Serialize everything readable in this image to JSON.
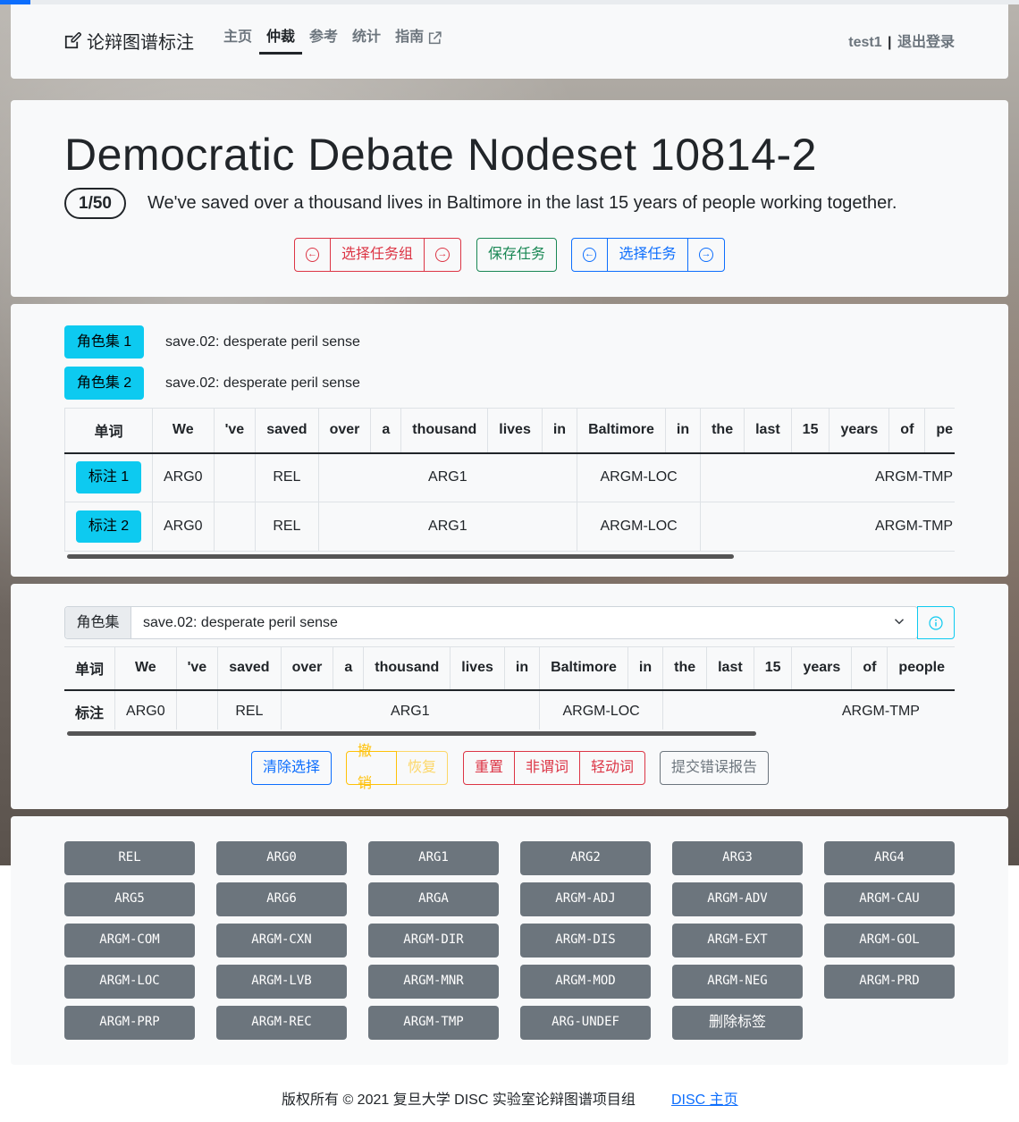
{
  "progress": 0.03,
  "colors": {
    "accent": "#0d6efd",
    "info": "#0dcaf0",
    "danger": "#dc3545",
    "success": "#198754",
    "warning": "#ffc107",
    "secondary": "#6c757d"
  },
  "nav": {
    "brand": "论辩图谱标注",
    "links": [
      "主页",
      "仲裁",
      "参考",
      "统计",
      "指南"
    ],
    "active": "仲裁",
    "user": "test1",
    "sep": "|",
    "logout": "退出登录"
  },
  "header": {
    "title": "Democratic Debate Nodeset 10814-2",
    "counter": "1/50",
    "sentence": "We've saved over a thousand lives in Baltimore in the last 15 years of people working together.",
    "select_group": "选择任务组",
    "save_task": "保存任务",
    "select_task": "选择任务"
  },
  "rolesets": [
    {
      "button": "角色集 1",
      "text": "save.02: desperate peril sense"
    },
    {
      "button": "角色集 2",
      "text": "save.02: desperate peril sense"
    }
  ],
  "table1": {
    "head": "单词",
    "words": [
      "We",
      "'ve",
      "saved",
      "over",
      "a",
      "thousand",
      "lives",
      "in",
      "Baltimore",
      "in",
      "the",
      "last",
      "15",
      "years",
      "of",
      "pe"
    ],
    "rows": [
      {
        "tag": "标注 1",
        "cells": [
          "ARG0",
          "",
          "REL",
          "ARG1",
          "ARGM-LOC",
          "ARGM-TMP"
        ]
      },
      {
        "tag": "标注 2",
        "cells": [
          "ARG0",
          "",
          "REL",
          "ARG1",
          "ARGM-LOC",
          "ARGM-TMP"
        ]
      }
    ]
  },
  "editor": {
    "roleset_label": "角色集",
    "roleset_value": "save.02: desperate peril sense",
    "head": "单词",
    "row_label": "标注",
    "words": [
      "We",
      "'ve",
      "saved",
      "over",
      "a",
      "thousand",
      "lives",
      "in",
      "Baltimore",
      "in",
      "the",
      "last",
      "15",
      "years",
      "of",
      "people"
    ],
    "cells": [
      "ARG0",
      "",
      "REL",
      "ARG1",
      "ARGM-LOC",
      "ARGM-TMP"
    ],
    "buttons": {
      "clear": "清除选择",
      "undo": "撤销",
      "redo": "恢复",
      "reset": "重置",
      "nonpred": "非谓词",
      "light": "轻动词",
      "report": "提交错误报告"
    }
  },
  "labels": [
    "REL",
    "ARG0",
    "ARG1",
    "ARG2",
    "ARG3",
    "ARG4",
    "ARG5",
    "ARG6",
    "ARGA",
    "ARGM-ADJ",
    "ARGM-ADV",
    "ARGM-CAU",
    "ARGM-COM",
    "ARGM-CXN",
    "ARGM-DIR",
    "ARGM-DIS",
    "ARGM-EXT",
    "ARGM-GOL",
    "ARGM-LOC",
    "ARGM-LVB",
    "ARGM-MNR",
    "ARGM-MOD",
    "ARGM-NEG",
    "ARGM-PRD",
    "ARGM-PRP",
    "ARGM-REC",
    "ARGM-TMP",
    "ARG-UNDEF",
    "删除标签"
  ],
  "footer": {
    "copyright": "版权所有 © 2021 复旦大学 DISC 实验室论辩图谱项目组",
    "link": "DISC 主页"
  }
}
